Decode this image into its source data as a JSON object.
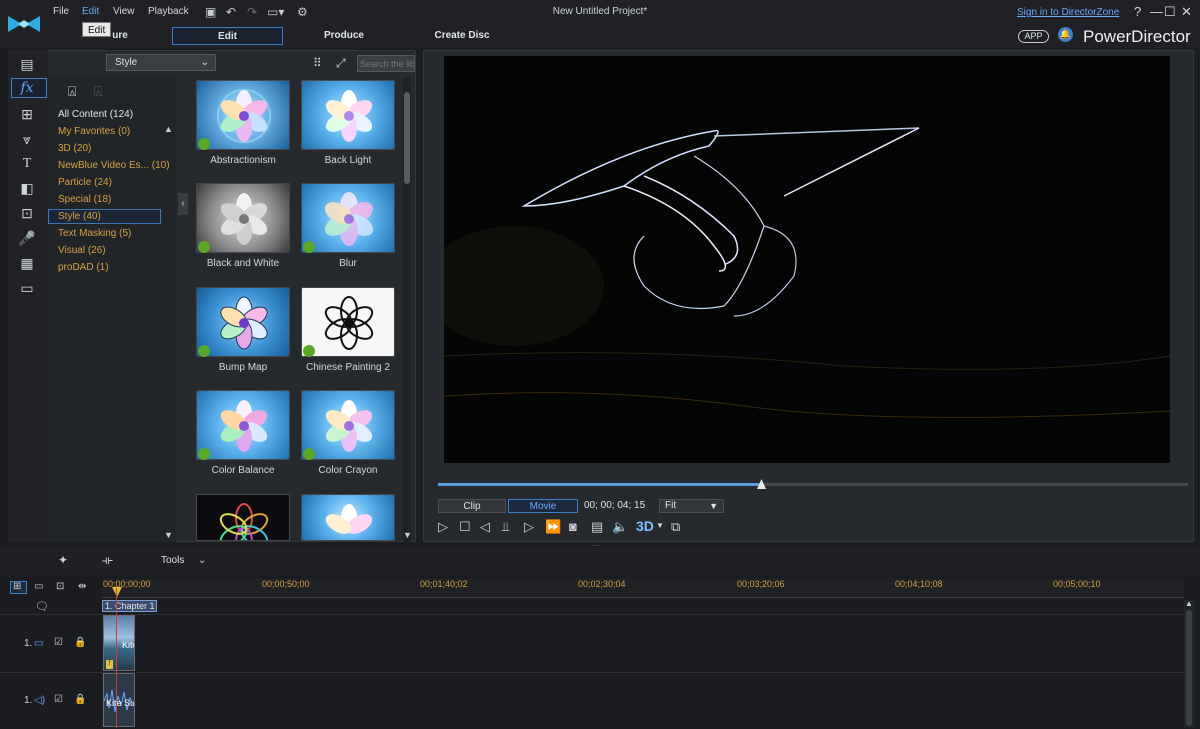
{
  "window": {
    "title": "New Untitled Project*",
    "sign_in": "Sign in to DirectorZone",
    "help": "?",
    "minimize": "—",
    "maximize": "☐",
    "close": "✕"
  },
  "menu": {
    "file": "File",
    "edit": "Edit",
    "view": "View",
    "playback": "Playback",
    "tooltip": "Edit"
  },
  "modes": {
    "capture": "ure",
    "edit": "Edit",
    "produce": "Produce",
    "create_disc": "Create Disc"
  },
  "brand": {
    "app_badge": "APP",
    "name": "PowerDirector"
  },
  "library": {
    "dropdown": "Style",
    "search_placeholder": "Search the lib",
    "categories": [
      {
        "label": "All Content  (124)"
      },
      {
        "label": "My Favorites  (0)"
      },
      {
        "label": "3D  (20)"
      },
      {
        "label": "NewBlue Video Es...  (10)"
      },
      {
        "label": "Particle  (24)"
      },
      {
        "label": "Special  (18)"
      },
      {
        "label": "Style  (40)"
      },
      {
        "label": "Text Masking  (5)"
      },
      {
        "label": "Visual  (26)"
      },
      {
        "label": "proDAD  (1)"
      }
    ],
    "tiles": [
      {
        "label": "Abstractionism"
      },
      {
        "label": "Back Light"
      },
      {
        "label": "Black and White"
      },
      {
        "label": "Blur"
      },
      {
        "label": "Bump Map"
      },
      {
        "label": "Chinese Painting 2"
      },
      {
        "label": "Color Balance"
      },
      {
        "label": "Color Crayon"
      }
    ]
  },
  "preview": {
    "seek_progress": 0.42,
    "clip_tab": "Clip",
    "movie_tab": "Movie",
    "timecode": "00; 00; 04; 15",
    "zoom": "Fit",
    "btn_3d": "3D"
  },
  "toolbar": {
    "tools": "Tools"
  },
  "timeline": {
    "ticks": [
      "00;00;00;00",
      "00;00;50;00",
      "00;01;40;02",
      "00;02;30;04",
      "00;03;20;06",
      "00;04;10;08",
      "00;05;00;10"
    ],
    "chapter": "1. Chapter 1",
    "video_track": "1.",
    "audio_track": "1.",
    "video_clip": "Kite",
    "audio_clip": "Kite Su"
  },
  "colors": {
    "accent": "#3b82c9",
    "category_text": "#d7a042",
    "playhead": "#d13a3a"
  }
}
